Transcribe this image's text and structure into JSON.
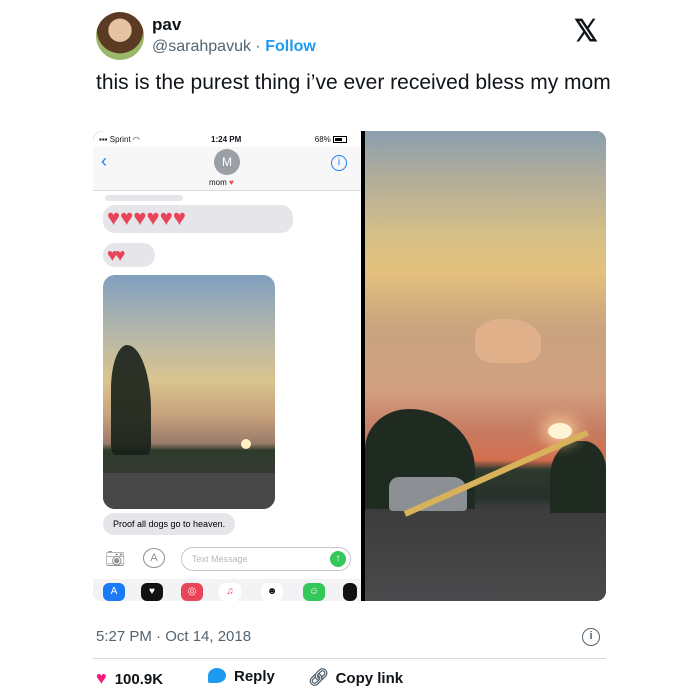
{
  "author": {
    "name": "pav",
    "handle": "@sarahpavuk",
    "separator": "·",
    "follow_label": "Follow"
  },
  "tweet": {
    "text": "this is the purest thing i’ve ever received bless my mom"
  },
  "imessage": {
    "status": {
      "carrier": "Sprint",
      "time": "1:24 PM",
      "battery": "68%"
    },
    "contact": {
      "initial": "M",
      "name": "mom"
    },
    "info_label": "i",
    "caption": "Proof all dogs go to heaven.",
    "input_placeholder": "Text Message"
  },
  "footer": {
    "timestamp": "5:27 PM · Oct 14, 2018",
    "likes": "100.9K",
    "reply_label": "Reply",
    "copy_link_label": "Copy link"
  },
  "colors": {
    "accent": "#1d9bf0",
    "like": "#f91880",
    "imessage_blue": "#1a7cf5",
    "heart_red": "#e8455a"
  }
}
